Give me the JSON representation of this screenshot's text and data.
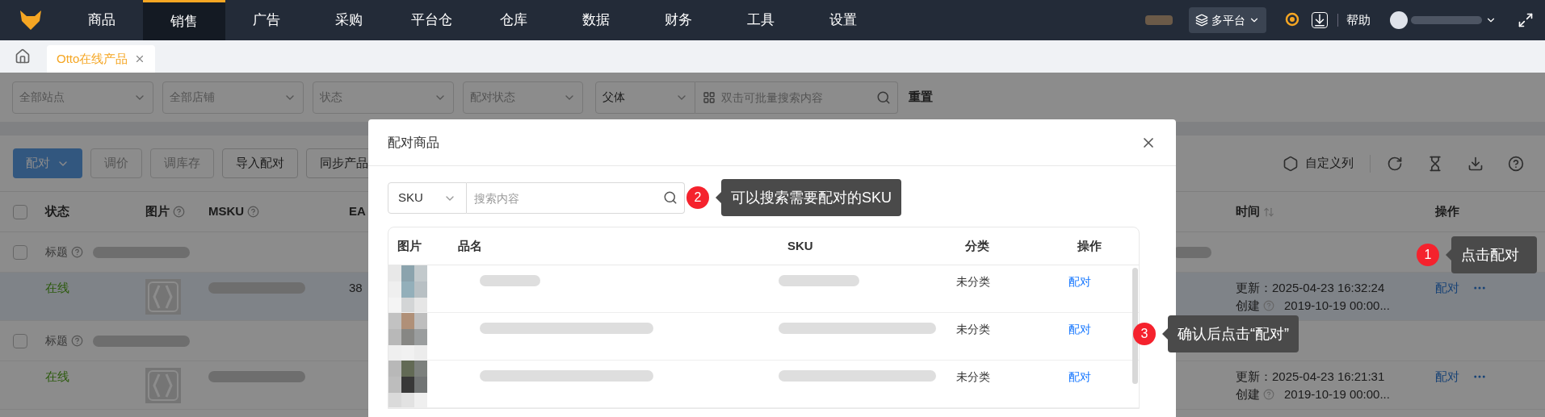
{
  "top_nav": {
    "items": [
      {
        "label": "商品",
        "selected": false
      },
      {
        "label": "销售",
        "selected": true
      },
      {
        "label": "广告",
        "selected": false
      },
      {
        "label": "采购",
        "selected": false
      },
      {
        "label": "平台仓",
        "selected": false
      },
      {
        "label": "仓库",
        "selected": false
      },
      {
        "label": "数据",
        "selected": false
      },
      {
        "label": "财务",
        "selected": false
      },
      {
        "label": "工具",
        "selected": false
      },
      {
        "label": "设置",
        "selected": false
      }
    ],
    "platform": "多平台",
    "help": "帮助"
  },
  "tabs": [
    {
      "label": "Otto在线产品",
      "selected": true
    }
  ],
  "filters": {
    "selects": [
      {
        "placeholder": "全部站点"
      },
      {
        "placeholder": "全部店铺"
      },
      {
        "placeholder": "状态"
      },
      {
        "placeholder": "配对状态"
      }
    ],
    "search_type": "父体",
    "search": {
      "placeholder": "双击可批量搜索内容"
    },
    "reset": "重置"
  },
  "toolbar": {
    "buttons": [
      {
        "label": "配对",
        "kind": "primary",
        "disabled": false
      },
      {
        "label": "调价",
        "kind": "default",
        "disabled": true
      },
      {
        "label": "调库存",
        "kind": "default",
        "disabled": true
      },
      {
        "label": "导入配对",
        "kind": "default",
        "disabled": false
      },
      {
        "label": "同步产品",
        "kind": "default",
        "disabled": false
      }
    ],
    "custom_columns": "自定义列"
  },
  "table": {
    "all_checked": false,
    "columns": {
      "status": "状态",
      "image": "图片",
      "msku": "MSKU",
      "column_4": "EA",
      "time": "时间",
      "actions": "操作"
    },
    "rows": [
      {
        "title_label": "标题",
        "checked": false,
        "highlighted": true,
        "status": "在线",
        "column_4": "38",
        "updated": "更新：2025-04-23 16:32:24",
        "created_label": "创建",
        "created": "2019-10-19 00:00...",
        "action": "配对"
      },
      {
        "title_label": "标题",
        "checked": false,
        "highlighted": false,
        "status": "在线",
        "updated": "更新：2025-04-23 16:21:31",
        "created_label": "创建",
        "created": "2019-10-19 00:00...",
        "action": "配对"
      }
    ]
  },
  "modal": {
    "title": "配对商品",
    "search_type": "SKU",
    "search": {
      "placeholder": "搜索内容"
    },
    "columns": [
      "图片",
      "品名",
      "SKU",
      "分类",
      "操作"
    ],
    "rows": [
      {
        "category": "未分类",
        "action": "配对"
      },
      {
        "category": "未分类",
        "action": "配对"
      },
      {
        "category": "未分类",
        "action": "配对"
      }
    ]
  },
  "annotations": [
    {
      "number": "1",
      "text": "点击配对"
    },
    {
      "number": "2",
      "text": "可以搜索需要配对的SKU"
    },
    {
      "number": "3",
      "text": "确认后点击“配对”"
    }
  ]
}
